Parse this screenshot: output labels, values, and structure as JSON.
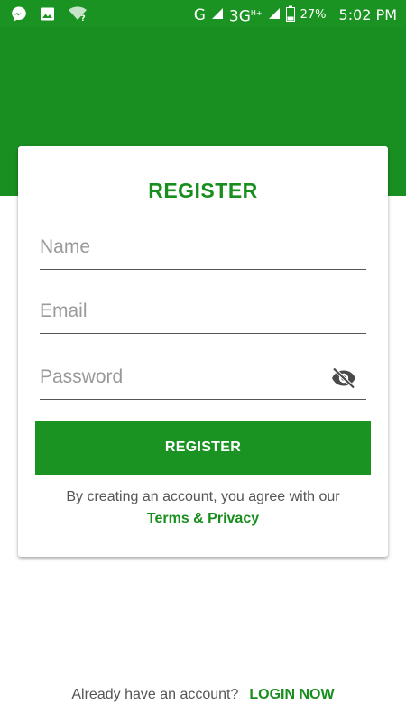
{
  "status_bar": {
    "network_g": "G",
    "network_3g": "3G",
    "network_3g_suffix": "H+",
    "battery_percent": "27%",
    "time": "5:02 PM",
    "left_icons": [
      "messenger-icon",
      "image-icon",
      "wifi-unknown-icon"
    ],
    "right_icons": [
      "signal-icon",
      "signal-icon",
      "battery-icon"
    ]
  },
  "colors": {
    "status_bar": "#1a9322",
    "header_band": "#1a8f21",
    "accent": "#178e1d",
    "button": "#1a9322",
    "background": "#ffffff"
  },
  "register_card": {
    "title": "REGISTER",
    "fields": {
      "name": {
        "placeholder": "Name",
        "value": ""
      },
      "email": {
        "placeholder": "Email",
        "value": ""
      },
      "password": {
        "placeholder": "Password",
        "value": "",
        "toggle_icon": "eye-off-icon"
      }
    },
    "submit_label": "REGISTER",
    "terms_text": "By creating an account, you agree with our",
    "terms_link": "Terms & Privacy"
  },
  "footer": {
    "prompt": "Already have an account?",
    "login_link": "LOGIN NOW"
  }
}
